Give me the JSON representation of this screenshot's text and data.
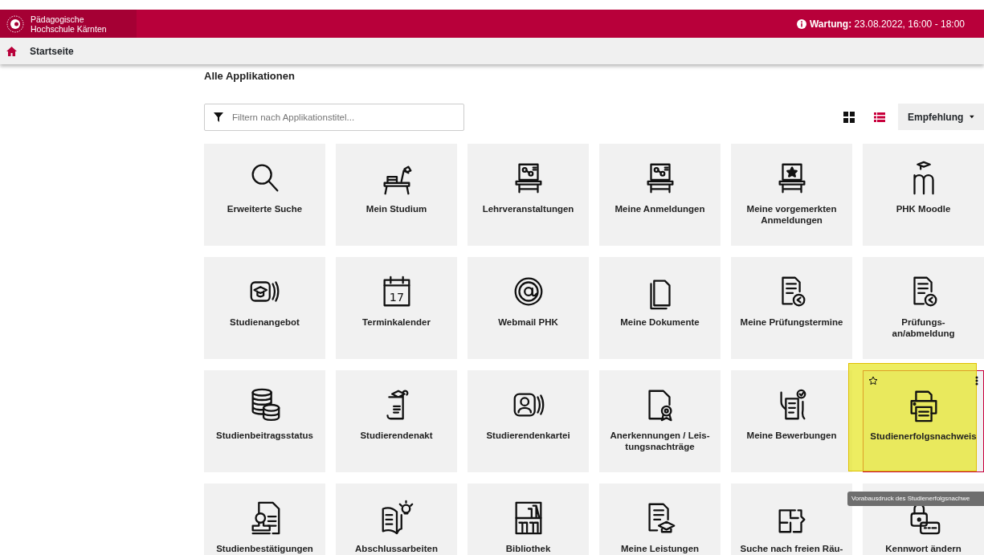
{
  "header": {
    "brand_lines": [
      "Pädagogische",
      "Hochschule Kärnten"
    ],
    "notice": "**Wartung:** 23.08.2022, 16:00 - 18:00"
  },
  "breadcrumb": {
    "label": "Startseite"
  },
  "heading": "Alle Applikationen",
  "filter": {
    "placeholder": "Filtern nach Applikationstitel..."
  },
  "view_toggles": [
    {
      "selected": true
    },
    {
      "selected": false
    }
  ],
  "sort": {
    "label": "Empfehlung"
  },
  "tiles": [
    {
      "label": "Erweiterte Suche",
      "hovered": false
    },
    {
      "label": "Mein Studium",
      "hovered": false
    },
    {
      "label": "Lehrveranstaltungen",
      "hovered": false
    },
    {
      "label": "Meine Anmeldungen",
      "hovered": false
    },
    {
      "label": "Meine vorgemerkten Anmeldungen",
      "hovered": false
    },
    {
      "label": "PHK Moodle",
      "hovered": false
    },
    {
      "label": "Studienangebot",
      "hovered": false
    },
    {
      "label": "Terminkalender",
      "hovered": false,
      "icon_text": "17"
    },
    {
      "label": "Webmail PHK",
      "hovered": false
    },
    {
      "label": "Meine Dokumente",
      "hovered": false
    },
    {
      "label": "Meine Prüfungstermine",
      "hovered": false
    },
    {
      "label": "Prüfungs-\nan/abmeldung",
      "hovered": false
    },
    {
      "label": "Studienbeitragsstatus",
      "hovered": false
    },
    {
      "label": "Studierendenakt",
      "hovered": false
    },
    {
      "label": "Studierendenkartei",
      "hovered": false
    },
    {
      "label": "Anerkennungen / Leis-\ntungsnachträge",
      "hovered": false
    },
    {
      "label": "Meine Bewerbungen",
      "hovered": false
    },
    {
      "label": "Studienerfolgsnachweis",
      "hovered": true,
      "highlighted": true
    },
    {
      "label": "Studienbestätigungen",
      "hovered": false
    },
    {
      "label": "Abschlussarbeiten",
      "hovered": false
    },
    {
      "label": "Bibliothek",
      "hovered": false
    },
    {
      "label": "Meine Leistungen",
      "hovered": false
    },
    {
      "label": "Suche nach freien Räu-",
      "hovered": false
    },
    {
      "label": "Kennwort ändern",
      "hovered": false
    }
  ],
  "tooltip": {
    "text": "Vorabausdruck des Studienerfolgsnachwe"
  }
}
